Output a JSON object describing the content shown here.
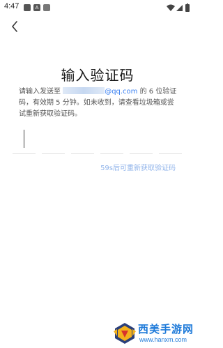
{
  "status_bar": {
    "time": "4:47",
    "left_icons": [
      "app-notification-icon",
      "a-notification-icon",
      "keyboard-icon"
    ],
    "right_icons": [
      "wifi-icon",
      "signal-icon",
      "battery-icon"
    ]
  },
  "header": {
    "back_icon": "back-chevron-icon"
  },
  "main": {
    "title": "输入验证码",
    "desc_prefix": "请输入发送至 ",
    "email_domain": "@qq.com",
    "desc_suffix": " 的 6 位验证码，有效期 5 分钟。如未收到，请查看垃圾箱或尝试重新获取验证码。",
    "code_length": 6,
    "resend_text": "59s后可重新获取验证码"
  },
  "watermark": {
    "title": "西美手游网",
    "url": "www.hanxm.com"
  },
  "colors": {
    "accent": "#3d82f2",
    "resend": "#8fb3ea",
    "title": "#1a1a1a",
    "desc": "#555555"
  }
}
